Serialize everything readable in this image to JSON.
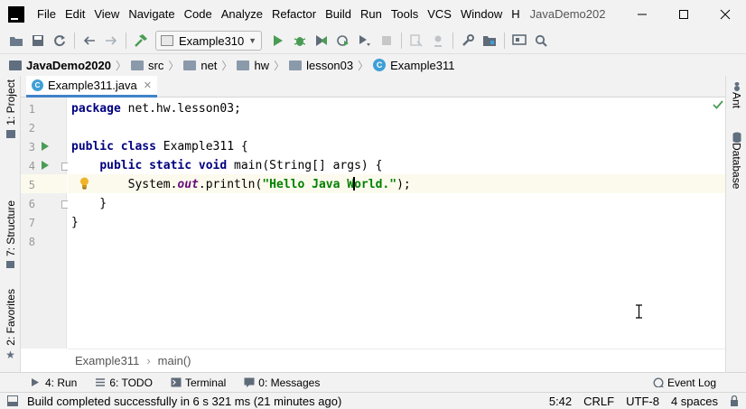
{
  "menubar": {
    "items": [
      {
        "label": "File",
        "mnemonic": "F"
      },
      {
        "label": "Edit",
        "mnemonic": "E"
      },
      {
        "label": "View",
        "mnemonic": "V"
      },
      {
        "label": "Navigate",
        "mnemonic": "N"
      },
      {
        "label": "Code",
        "mnemonic": "C"
      },
      {
        "label": "Analyze",
        "mnemonic": "z"
      },
      {
        "label": "Refactor",
        "mnemonic": "R"
      },
      {
        "label": "Build",
        "mnemonic": "B"
      },
      {
        "label": "Run",
        "mnemonic": "u"
      },
      {
        "label": "Tools",
        "mnemonic": "T"
      },
      {
        "label": "VCS",
        "mnemonic": "S"
      },
      {
        "label": "Window",
        "mnemonic": "W"
      },
      {
        "label": "H",
        "mnemonic": "H"
      }
    ],
    "window_title": "JavaDemo202"
  },
  "toolbar": {
    "run_config": "Example310"
  },
  "navbar": {
    "crumbs": [
      "JavaDemo2020",
      "src",
      "net",
      "hw",
      "lesson03",
      "Example311"
    ]
  },
  "left_strip": {
    "project": "1: Project",
    "structure": "7: Structure",
    "favorites": "2: Favorites"
  },
  "right_strip": {
    "ant": "Ant",
    "database": "Database"
  },
  "editor": {
    "tab_label": "Example311.java",
    "line_numbers": [
      "1",
      "2",
      "3",
      "4",
      "5",
      "6",
      "7",
      "8"
    ],
    "code": {
      "l1_kw": "package",
      "l1_rest": " net.hw.lesson03;",
      "l3_kw": "public class",
      "l3_rest": " Example311 {",
      "l4_indent": "    ",
      "l4_kw": "public static void",
      "l4_rest": " main(String[] args) {",
      "l5_indent": "        System.",
      "l5_field": "out",
      "l5_mid": ".println(",
      "l5_str_a": "\"Hello Java W",
      "l5_str_b": "orld.\"",
      "l5_end": ");",
      "l6": "    }",
      "l7": "}"
    },
    "crumbs": [
      "Example311",
      "main()"
    ]
  },
  "bottom_bar": {
    "run": "4: Run",
    "todo": "6: TODO",
    "terminal": "Terminal",
    "messages": "0: Messages",
    "event_log": "Event Log"
  },
  "status_bar": {
    "message": "Build completed successfully in 6 s 321 ms (21 minutes ago)",
    "position": "5:42",
    "line_sep": "CRLF",
    "encoding": "UTF-8",
    "indent": "4 spaces"
  },
  "colors": {
    "keyword": "#000080",
    "string": "#008000",
    "field": "#660e7a",
    "run_green": "#499c54",
    "tab_accent": "#4083c9"
  }
}
